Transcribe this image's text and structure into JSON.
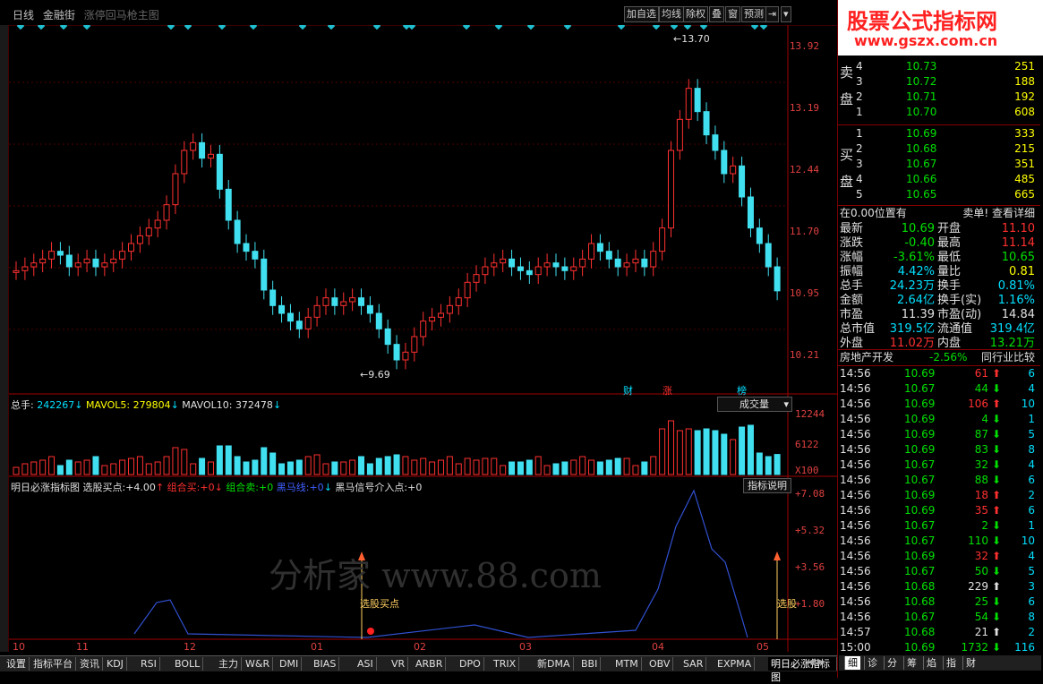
{
  "toolbar": {
    "period": "日线",
    "name": "金融街",
    "subtitle": "涨停回马枪主图",
    "buttons": [
      "加自选",
      "均线",
      "除权",
      "叠",
      "窗",
      "预测"
    ]
  },
  "price_axis": [
    "13.92",
    "13.19",
    "12.44",
    "11.70",
    "10.95",
    "10.21"
  ],
  "price_marks": {
    "high": "13.70",
    "low": "9.69"
  },
  "event_tags": [
    {
      "text": "财",
      "color": "#00e0ff"
    },
    {
      "text": "涨",
      "color": "#ff3030"
    },
    {
      "text": "榜",
      "color": "#00e0ff"
    }
  ],
  "volume": {
    "header": {
      "total_label": "总手:",
      "total": "242267",
      "ma5_label": "MAVOL5:",
      "ma5": "279804",
      "ma10_label": "MAVOL10:",
      "ma10": "372478"
    },
    "dropdown": "成交量",
    "axis": [
      "12244",
      "6122",
      "X100"
    ]
  },
  "indicator": {
    "header": {
      "name": "明日必涨指标图",
      "buy_label": "选股买点:",
      "buy_val": "+4.00",
      "combo_buy": "组合买:",
      "combo_buy_val": "+0",
      "combo_sell": "组合卖:",
      "combo_sell_val": "+0",
      "black_horse": "黑马线:",
      "black_horse_val": "+0",
      "signal": "黑马信号介入点:",
      "signal_val": "+0"
    },
    "help": "指标说明",
    "axis": [
      "+7.08",
      "+5.32",
      "+3.56",
      "+1.80"
    ],
    "mark_label": "选股买点",
    "mark_label_right": "选股",
    "watermark": "分析家  www.88.com"
  },
  "date_axis": [
    "10",
    "11",
    "12",
    "01",
    "02",
    "03",
    "04",
    "05"
  ],
  "bottom_tabs": [
    "设置",
    "指标平台",
    "资讯",
    "KDJ",
    "RSI",
    "BOLL",
    "主力",
    "W&R",
    "DMI",
    "BIAS",
    "ASI",
    "VR",
    "ARBR",
    "DPO",
    "TRIX",
    "新DMA",
    "BBI",
    "MTM",
    "OBV",
    "SAR",
    "EXPMA",
    "明日必涨指标图"
  ],
  "logo": {
    "line1": "股票公式指标网",
    "line2": "www.gszx.com.cn"
  },
  "sell_label": [
    "卖",
    "盘"
  ],
  "buy_label": [
    "买",
    "盘"
  ],
  "asks": [
    {
      "lvl": "4",
      "price": "10.73",
      "vol": "251"
    },
    {
      "lvl": "3",
      "price": "10.72",
      "vol": "188"
    },
    {
      "lvl": "2",
      "price": "10.71",
      "vol": "192"
    },
    {
      "lvl": "1",
      "price": "10.70",
      "vol": "608"
    }
  ],
  "bids": [
    {
      "lvl": "1",
      "price": "10.69",
      "vol": "333"
    },
    {
      "lvl": "2",
      "price": "10.68",
      "vol": "215"
    },
    {
      "lvl": "3",
      "price": "10.67",
      "vol": "351"
    },
    {
      "lvl": "4",
      "price": "10.66",
      "vol": "485"
    },
    {
      "lvl": "5",
      "price": "10.65",
      "vol": "665"
    }
  ],
  "position_line": {
    "left": "在0.00位置有",
    "right": "卖单! 查看详细"
  },
  "stats": [
    {
      "l1": "最新",
      "v1": "10.69",
      "c1": "g",
      "l2": "开盘",
      "v2": "11.10",
      "c2": "r"
    },
    {
      "l1": "涨跌",
      "v1": "-0.40",
      "c1": "g",
      "l2": "最高",
      "v2": "11.14",
      "c2": "r"
    },
    {
      "l1": "涨幅",
      "v1": "-3.61%",
      "c1": "g",
      "l2": "最低",
      "v2": "10.65",
      "c2": "g"
    },
    {
      "l1": "振幅",
      "v1": "4.42%",
      "c1": "c",
      "l2": "量比",
      "v2": "0.81",
      "c2": "y"
    },
    {
      "l1": "总手",
      "v1": "24.23万",
      "c1": "c",
      "l2": "换手",
      "v2": "0.81%",
      "c2": "c"
    },
    {
      "l1": "金额",
      "v1": "2.64亿",
      "c1": "c",
      "l2": "换手(实)",
      "v2": "1.16%",
      "c2": "c"
    },
    {
      "l1": "市盈",
      "v1": "11.39",
      "c1": "w",
      "l2": "市盈(动)",
      "v2": "14.84",
      "c2": "w"
    },
    {
      "l1": "总市值",
      "v1": "319.5亿",
      "c1": "c",
      "l2": "流通值",
      "v2": "319.4亿",
      "c2": "c"
    },
    {
      "l1": "外盘",
      "v1": "11.02万",
      "c1": "r",
      "l2": "内盘",
      "v2": "13.21万",
      "c2": "g"
    }
  ],
  "industry": {
    "name": "房地产开发",
    "change": "-2.56%",
    "link": "同行业比较"
  },
  "ticks": [
    {
      "t": "14:56",
      "p": "10.69",
      "v": "61",
      "d": "up",
      "n": "6"
    },
    {
      "t": "14:56",
      "p": "10.67",
      "v": "44",
      "d": "down",
      "n": "4"
    },
    {
      "t": "14:56",
      "p": "10.69",
      "v": "106",
      "d": "up",
      "n": "10"
    },
    {
      "t": "14:56",
      "p": "10.69",
      "v": "4",
      "d": "down",
      "n": "1"
    },
    {
      "t": "14:56",
      "p": "10.69",
      "v": "87",
      "d": "down",
      "n": "5"
    },
    {
      "t": "14:56",
      "p": "10.69",
      "v": "83",
      "d": "down",
      "n": "8"
    },
    {
      "t": "14:56",
      "p": "10.67",
      "v": "32",
      "d": "down",
      "n": "4"
    },
    {
      "t": "14:56",
      "p": "10.67",
      "v": "88",
      "d": "down",
      "n": "6"
    },
    {
      "t": "14:56",
      "p": "10.69",
      "v": "18",
      "d": "up",
      "n": "2"
    },
    {
      "t": "14:56",
      "p": "10.69",
      "v": "35",
      "d": "up",
      "n": "6"
    },
    {
      "t": "14:56",
      "p": "10.67",
      "v": "2",
      "d": "down",
      "n": "1"
    },
    {
      "t": "14:56",
      "p": "10.67",
      "v": "110",
      "d": "down",
      "n": "10"
    },
    {
      "t": "14:56",
      "p": "10.69",
      "v": "32",
      "d": "up",
      "n": "4"
    },
    {
      "t": "14:56",
      "p": "10.67",
      "v": "50",
      "d": "down",
      "n": "5"
    },
    {
      "t": "14:56",
      "p": "10.68",
      "v": "229",
      "d": "white",
      "n": "3"
    },
    {
      "t": "14:56",
      "p": "10.68",
      "v": "25",
      "d": "down",
      "n": "6"
    },
    {
      "t": "14:56",
      "p": "10.67",
      "v": "54",
      "d": "down",
      "n": "8"
    },
    {
      "t": "14:57",
      "p": "10.68",
      "v": "21",
      "d": "white",
      "n": "2"
    },
    {
      "t": "15:00",
      "p": "10.69",
      "v": "1732",
      "d": "down",
      "n": "116"
    }
  ],
  "right_tabs": [
    "细",
    "诊",
    "分",
    "筹",
    "焰",
    "指",
    "财"
  ],
  "chart_data": {
    "type": "candlestick",
    "ylim": [
      9.5,
      14.0
    ],
    "high": 13.7,
    "low": 9.69,
    "price_ticks": [
      13.92,
      13.19,
      12.44,
      11.7,
      10.95,
      10.21
    ],
    "volume_ticks": [
      12244,
      6122
    ],
    "indicator_ticks": [
      7.08,
      5.32,
      3.56,
      1.8
    ],
    "months": [
      "10",
      "11",
      "12",
      "01",
      "02",
      "03",
      "04",
      "05"
    ]
  }
}
